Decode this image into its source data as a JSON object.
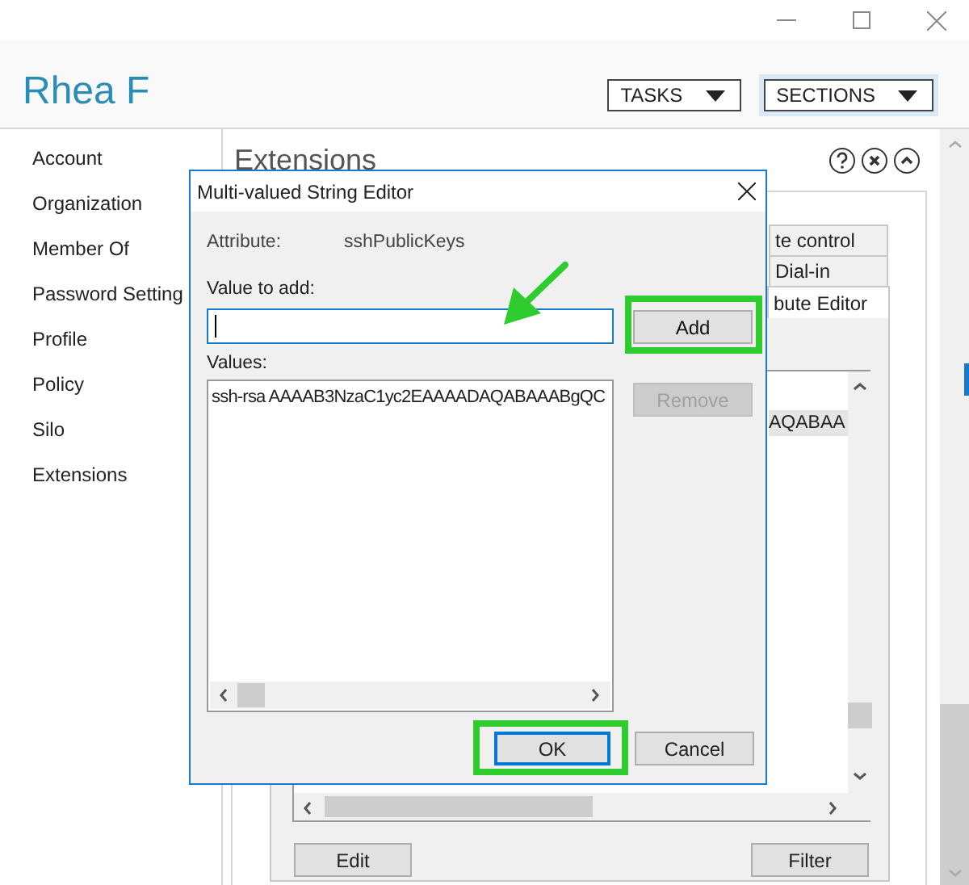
{
  "header": {
    "title": "Rhea F",
    "buttons": [
      {
        "label": "TASKS",
        "focused": false
      },
      {
        "label": "SECTIONS",
        "focused": true
      }
    ]
  },
  "nav": {
    "items": [
      {
        "label": "Account"
      },
      {
        "label": "Organization"
      },
      {
        "label": "Member Of"
      },
      {
        "label": "Password Setting"
      },
      {
        "label": "Profile"
      },
      {
        "label": "Policy"
      },
      {
        "label": "Silo"
      },
      {
        "label": "Extensions"
      }
    ]
  },
  "section": {
    "title": "Extensions",
    "tabs": [
      {
        "label": "te control",
        "selected": false
      },
      {
        "label": "Dial-in",
        "selected": false
      },
      {
        "label": "bute Editor",
        "selected": true
      }
    ],
    "attribute_rows": [
      {
        "text": "AQABAA",
        "selected": true
      }
    ],
    "buttons": [
      {
        "label": "Edit"
      },
      {
        "label": "Filter"
      }
    ]
  },
  "dialog": {
    "title": "Multi-valued String Editor",
    "attribute_label": "Attribute:",
    "attribute_value": "sshPublicKeys",
    "input_label": "Value to add:",
    "values_label": "Values:",
    "values": [
      "ssh-rsa AAAAB3NzaC1yc2EAAAADAQABAAABgQC"
    ],
    "side_buttons": [
      {
        "label": "Add",
        "disabled": false,
        "highlighted": true
      },
      {
        "label": "Remove",
        "disabled": true,
        "highlighted": false
      }
    ],
    "footer_buttons": [
      {
        "label": "OK",
        "default": true,
        "highlighted": true
      },
      {
        "label": "Cancel",
        "default": false,
        "highlighted": false
      }
    ]
  }
}
